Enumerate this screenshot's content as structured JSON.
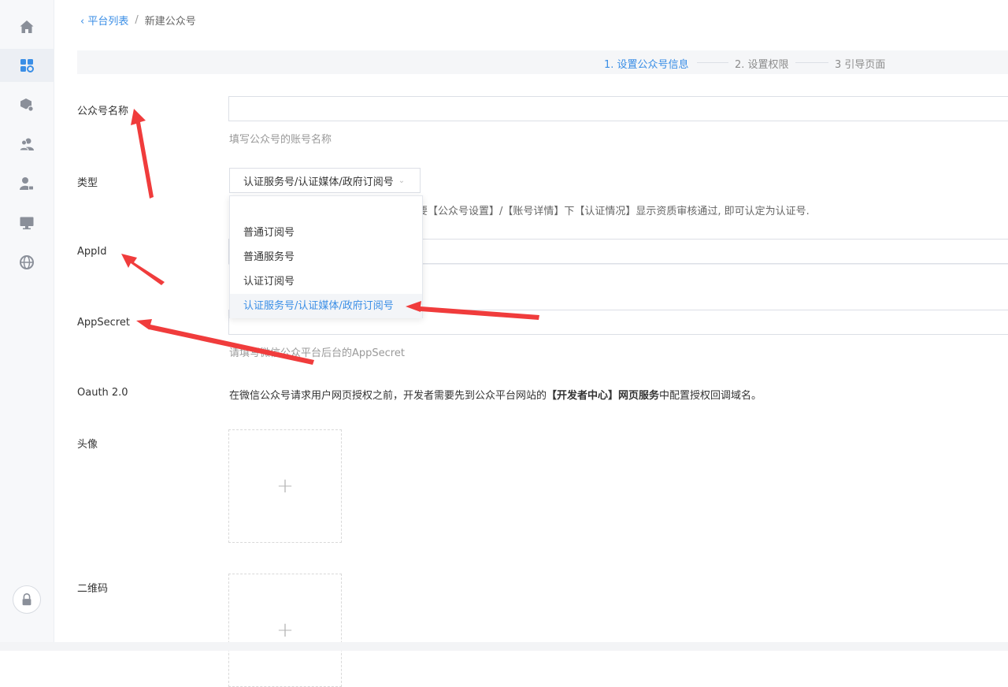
{
  "breadcrumb": {
    "back_label": "平台列表",
    "separator": "/",
    "current": "新建公众号"
  },
  "steps": [
    {
      "label": "1. 设置公众号信息",
      "active": true
    },
    {
      "label": "2. 设置权限",
      "active": false
    },
    {
      "label": "3 引导页面",
      "active": false
    }
  ],
  "sidebar": {
    "items": [
      {
        "icon": "home-icon",
        "active": false
      },
      {
        "icon": "apps-settings-icon",
        "active": true
      },
      {
        "icon": "box-settings-icon",
        "active": false
      },
      {
        "icon": "users-icon",
        "active": false
      },
      {
        "icon": "user-lock-icon",
        "active": false
      },
      {
        "icon": "monitor-icon",
        "active": false
      },
      {
        "icon": "globe-icon",
        "active": false
      }
    ],
    "lock_icon": "lock-icon"
  },
  "form": {
    "name": {
      "label": "公众号名称",
      "value": "",
      "hint": "填写公众号的账号名称"
    },
    "type": {
      "label": "类型",
      "selected": "认证服务号/认证媒体/政府订阅号",
      "hint_visible": "只要【公众号设置】/【账号详情】下【认证情况】显示资质审核通过, 即可认定为认证号.",
      "options": [
        "普通订阅号",
        "普通服务号",
        "认证订阅号",
        "认证服务号/认证媒体/政府订阅号"
      ]
    },
    "appid": {
      "label": "AppId",
      "value": ""
    },
    "appsecret": {
      "label": "AppSecret",
      "value": "",
      "hint": "请填写微信公众平台后台的AppSecret"
    },
    "oauth": {
      "label": "Oauth 2.0",
      "text_before": "在微信公众号请求用户网页授权之前，开发者需要先到公众平台网站的",
      "text_bold": "【开发者中心】网页服务",
      "text_after": "中配置授权回调域名。"
    },
    "avatar": {
      "label": "头像",
      "plus": "+"
    },
    "qrcode": {
      "label": "二维码",
      "plus": "+"
    }
  },
  "colors": {
    "accent": "#3a8ee6",
    "annotation_arrow": "#f03c3c"
  }
}
